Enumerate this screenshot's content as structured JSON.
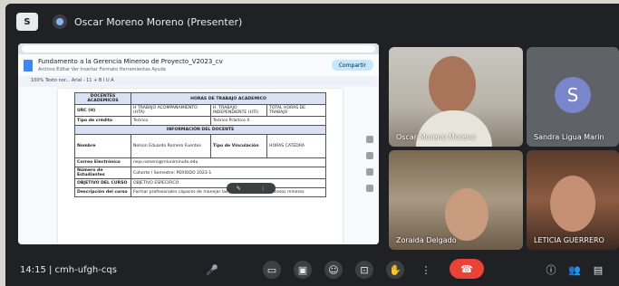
{
  "topbar": {
    "app_label": "S",
    "presenter_label": "Oscar Moreno Moreno (Presenter)"
  },
  "shared_screen": {
    "doc_title": "Fundamento a la Gerencia Mineroo de Proyecto_V2023_cv",
    "menu": "Archivo  Editar  Ver  Insertar  Formato  Herramientas  Ayuda",
    "share_label": "Compartir",
    "toolbar_text": "100%  Texto nor...  Arial  -  11  +  B  I  U  A",
    "table": {
      "col_headers": [
        "DOCENTES ACADEMICOS",
        "HORAS DE TRABAJO ACADEMICO"
      ],
      "row_urc": {
        "label": "URC (H)",
        "c1": "H TRABAJO ACOMPAÑAMIENTO (HTA)",
        "c2": "H. TRABAJO INDEPENDIENTE (HTI)",
        "c3": "TOTAL  HORAS DE TRABAJO"
      },
      "row_tipo": {
        "label": "Tipo de crédito",
        "c1": "Teórico",
        "c2": "Teórico Práctico  X"
      },
      "section_header": "INFORMACIÓN DEL DOCENTE",
      "row_nombre": {
        "label": "Nombre",
        "value": "Nelson Eduardo Romero Fuentes",
        "vinc_label": "Tipo de Vinculación",
        "vinc_value": "HORAS CATEDRA"
      },
      "row_correo": {
        "label": "Correo Electrónico",
        "value": "nejo.romero@miuniminuto.edu"
      },
      "row_estudiantes": {
        "label": "Número de Estudiantes",
        "value": "Cohorte / Semestre: PERIODO 2023-1"
      },
      "row_objetivo": {
        "label": "OBJETIVO DEL CURSO",
        "value": "OBJETIVO ESPECIFICO"
      },
      "row_desc": {
        "label": "Descripción del curso",
        "value": "Formar profesionales capaces de manejar las diferentes fases y procesos mineros"
      }
    }
  },
  "participants": [
    {
      "name": "Oscar Moreno Moreno"
    },
    {
      "name": "Sandra Ligua Marin",
      "initial": "S"
    },
    {
      "name": "Zoraida Delgado"
    },
    {
      "name": "LETICIA GUERRERO"
    }
  ],
  "bottombar": {
    "meeting_info": "14:15  |  cmh-ufgh-cqs",
    "controls": [
      "mic-icon",
      "camera-icon",
      "captions-icon",
      "present-icon",
      "emoji-icon",
      "hand-icon",
      "more-icon",
      "end-call-icon",
      "info-icon",
      "people-icon",
      "chat-icon"
    ]
  },
  "colors": {
    "background": "#202124",
    "end_call": "#ea4335",
    "avatar": "#7986cb"
  }
}
